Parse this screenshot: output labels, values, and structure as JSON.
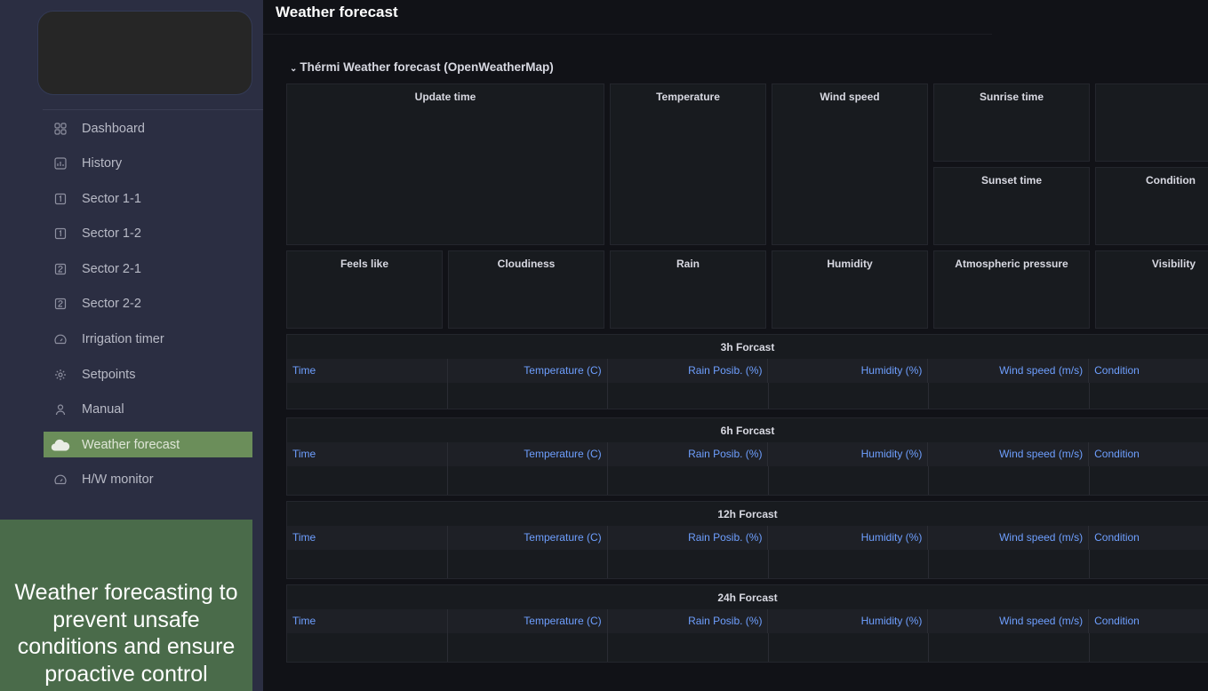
{
  "page": {
    "title": "Weather forecast"
  },
  "sidebar": {
    "items": [
      {
        "label": "Dashboard",
        "icon": "grid-icon"
      },
      {
        "label": "History",
        "icon": "chart-icon"
      },
      {
        "label": "Sector 1-1",
        "icon": "square-one-icon"
      },
      {
        "label": "Sector 1-2",
        "icon": "square-one-icon"
      },
      {
        "label": "Sector 2-1",
        "icon": "square-two-icon"
      },
      {
        "label": "Sector 2-2",
        "icon": "square-two-icon"
      },
      {
        "label": "Irrigation timer",
        "icon": "gauge-icon"
      },
      {
        "label": "Setpoints",
        "icon": "gear-icon"
      },
      {
        "label": "Manual",
        "icon": "user-icon"
      },
      {
        "label": "Weather forecast",
        "icon": "cloud-icon",
        "active": true
      },
      {
        "label": "H/W monitor",
        "icon": "gauge-icon"
      }
    ],
    "promo": "Weather forecasting to prevent unsafe conditions and ensure proactive control"
  },
  "row": {
    "title": "Thérmi Weather forecast (OpenWeatherMap)"
  },
  "stats": {
    "update_time": "Update time",
    "temperature": "Temperature",
    "wind_speed": "Wind speed",
    "sunrise_time": "Sunrise time",
    "sunset_time": "Sunset time",
    "condition": "Condition",
    "feels_like": "Feels like",
    "cloudiness": "Cloudiness",
    "rain": "Rain",
    "humidity": "Humidity",
    "atmospheric_pressure": "Atmospheric pressure",
    "visibility": "Visibility"
  },
  "columns": {
    "time": "Time",
    "temperature": "Temperature (C)",
    "rain": "Rain Posib. (%)",
    "humidity": "Humidity (%)",
    "wind": "Wind speed (m/s)",
    "condition": "Condition"
  },
  "tables": [
    {
      "title": "3h Forcast"
    },
    {
      "title": "6h Forcast"
    },
    {
      "title": "12h Forcast"
    },
    {
      "title": "24h Forcast"
    }
  ],
  "colors": {
    "accent": "#6b8e5a",
    "link": "#6e9fff",
    "promo": "#4a6b4a"
  }
}
